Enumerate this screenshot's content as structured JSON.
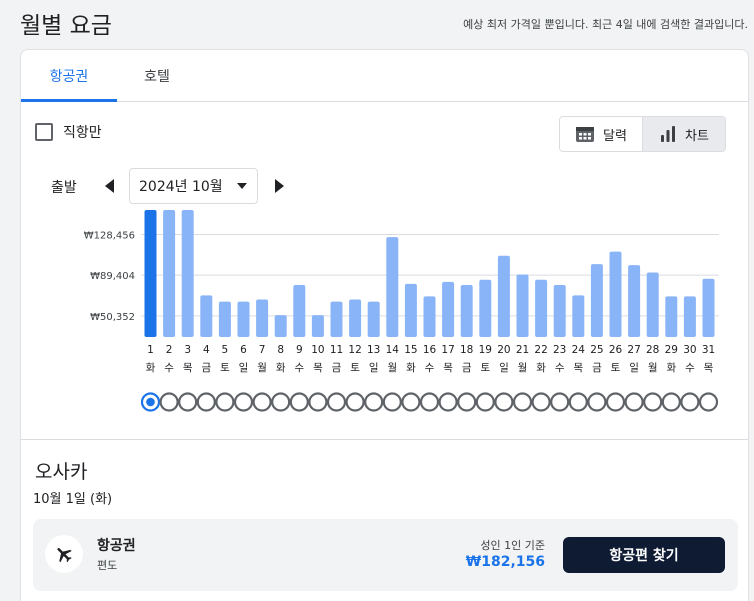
{
  "header": {
    "title": "월별 요금",
    "disclaimer": "예상 최저 가격일 뿐입니다. 최근 4일 내에 검색한 결과입니다."
  },
  "tabs": [
    {
      "label": "항공권",
      "selected": true
    },
    {
      "label": "호텔",
      "selected": false
    }
  ],
  "filters": {
    "direct_label": "직항만",
    "direct_checked": false
  },
  "view_toggle": {
    "calendar_label": "달력",
    "chart_label": "차트",
    "selected": "chart"
  },
  "depart": {
    "label": "출발",
    "month": "2024년 10월"
  },
  "chart_data": {
    "type": "bar",
    "title": "",
    "xlabel": "",
    "ylabel": "",
    "y_ticks": [
      50352,
      89404,
      128456
    ],
    "y_tick_labels": [
      "₩50,352",
      "₩89,404",
      "₩128,456"
    ],
    "ylim": [
      30000,
      152000
    ],
    "grid": true,
    "selected_index": 0,
    "categories": [
      "1",
      "2",
      "3",
      "4",
      "5",
      "6",
      "7",
      "8",
      "9",
      "10",
      "11",
      "12",
      "13",
      "14",
      "15",
      "16",
      "17",
      "18",
      "19",
      "20",
      "21",
      "22",
      "23",
      "24",
      "25",
      "26",
      "27",
      "28",
      "29",
      "30",
      "31"
    ],
    "weekdays": [
      "화",
      "수",
      "목",
      "금",
      "토",
      "일",
      "월",
      "화",
      "수",
      "목",
      "금",
      "토",
      "일",
      "월",
      "화",
      "수",
      "목",
      "금",
      "토",
      "일",
      "월",
      "화",
      "수",
      "목",
      "금",
      "토",
      "일",
      "월",
      "화",
      "수",
      "목"
    ],
    "values": [
      182156,
      182156,
      182156,
      70000,
      64000,
      64000,
      66000,
      51000,
      80000,
      51000,
      64000,
      66000,
      64000,
      126000,
      81000,
      69000,
      83000,
      80000,
      85000,
      108000,
      90000,
      85000,
      80000,
      70000,
      100000,
      112000,
      99000,
      92000,
      69000,
      69000,
      86000
    ],
    "colors": {
      "bar": "#8ab4f8",
      "selected_bar": "#1a73e8",
      "grid": "#dadce0"
    }
  },
  "selected": {
    "destination": "오사카",
    "date": "10월 1일 (화)",
    "type": "항공권",
    "trip": "편도",
    "price_basis": "성인 1인 기준",
    "price": "₩182,156",
    "button_label": "항공편 찾기"
  },
  "icons": {
    "calendar": "calendar-icon",
    "chart": "bar-chart-icon",
    "plane": "airplane-icon"
  }
}
